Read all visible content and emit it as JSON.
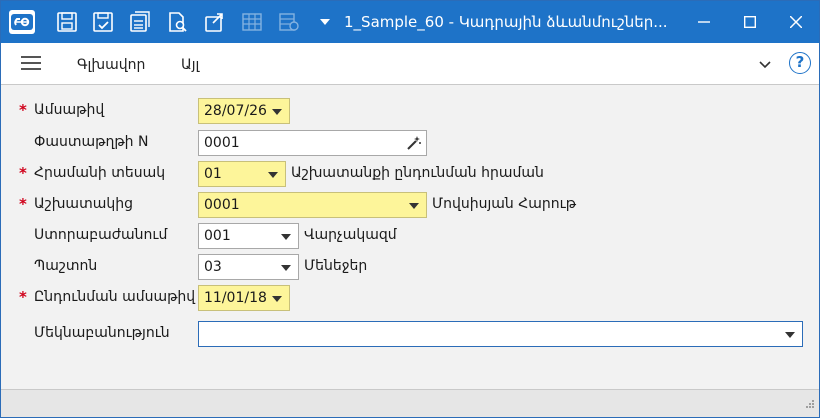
{
  "window": {
    "title": "1_Sample_60 - Կադրային ձևանմուշներ...",
    "minimize_label": "",
    "maximize_label": "",
    "close_label": ""
  },
  "toolbar": {
    "icons": [
      "save-icon",
      "save-check-icon",
      "save-list-icon",
      "document-search-icon",
      "export-icon",
      "table-icon",
      "table-settings-icon"
    ]
  },
  "menu": {
    "items": [
      {
        "label": "Գլխավոր"
      },
      {
        "label": "Այլ"
      }
    ]
  },
  "form": {
    "fields": [
      {
        "label": "Ամսաթիվ",
        "required": true,
        "value": "28/07/26",
        "side_text": ""
      },
      {
        "label": "Փաստաթղթի N",
        "required": false,
        "value": "0001",
        "side_text": ""
      },
      {
        "label": "Հրամանի տեսակ",
        "required": true,
        "value": "01",
        "side_text": "Աշխատանքի ընդունման հրաման"
      },
      {
        "label": "Աշխատակից",
        "required": true,
        "value": "0001",
        "side_text": "Մովսիսյան Հարութ"
      },
      {
        "label": "Ստորաբաժանում",
        "required": false,
        "value": "001",
        "side_text": "Վարչակազմ"
      },
      {
        "label": "Պաշտոն",
        "required": false,
        "value": "03",
        "side_text": "Մենեջեր"
      },
      {
        "label": "Ընդունման ամսաթիվ",
        "required": true,
        "value": "11/01/18",
        "side_text": ""
      },
      {
        "label": "Մեկնաբանություն",
        "required": false,
        "value": "",
        "side_text": ""
      }
    ],
    "required_marker": "*"
  },
  "colors": {
    "titlebar": "#1e73c8",
    "required_field": "#fdf59a",
    "required_marker": "#d0021b"
  }
}
